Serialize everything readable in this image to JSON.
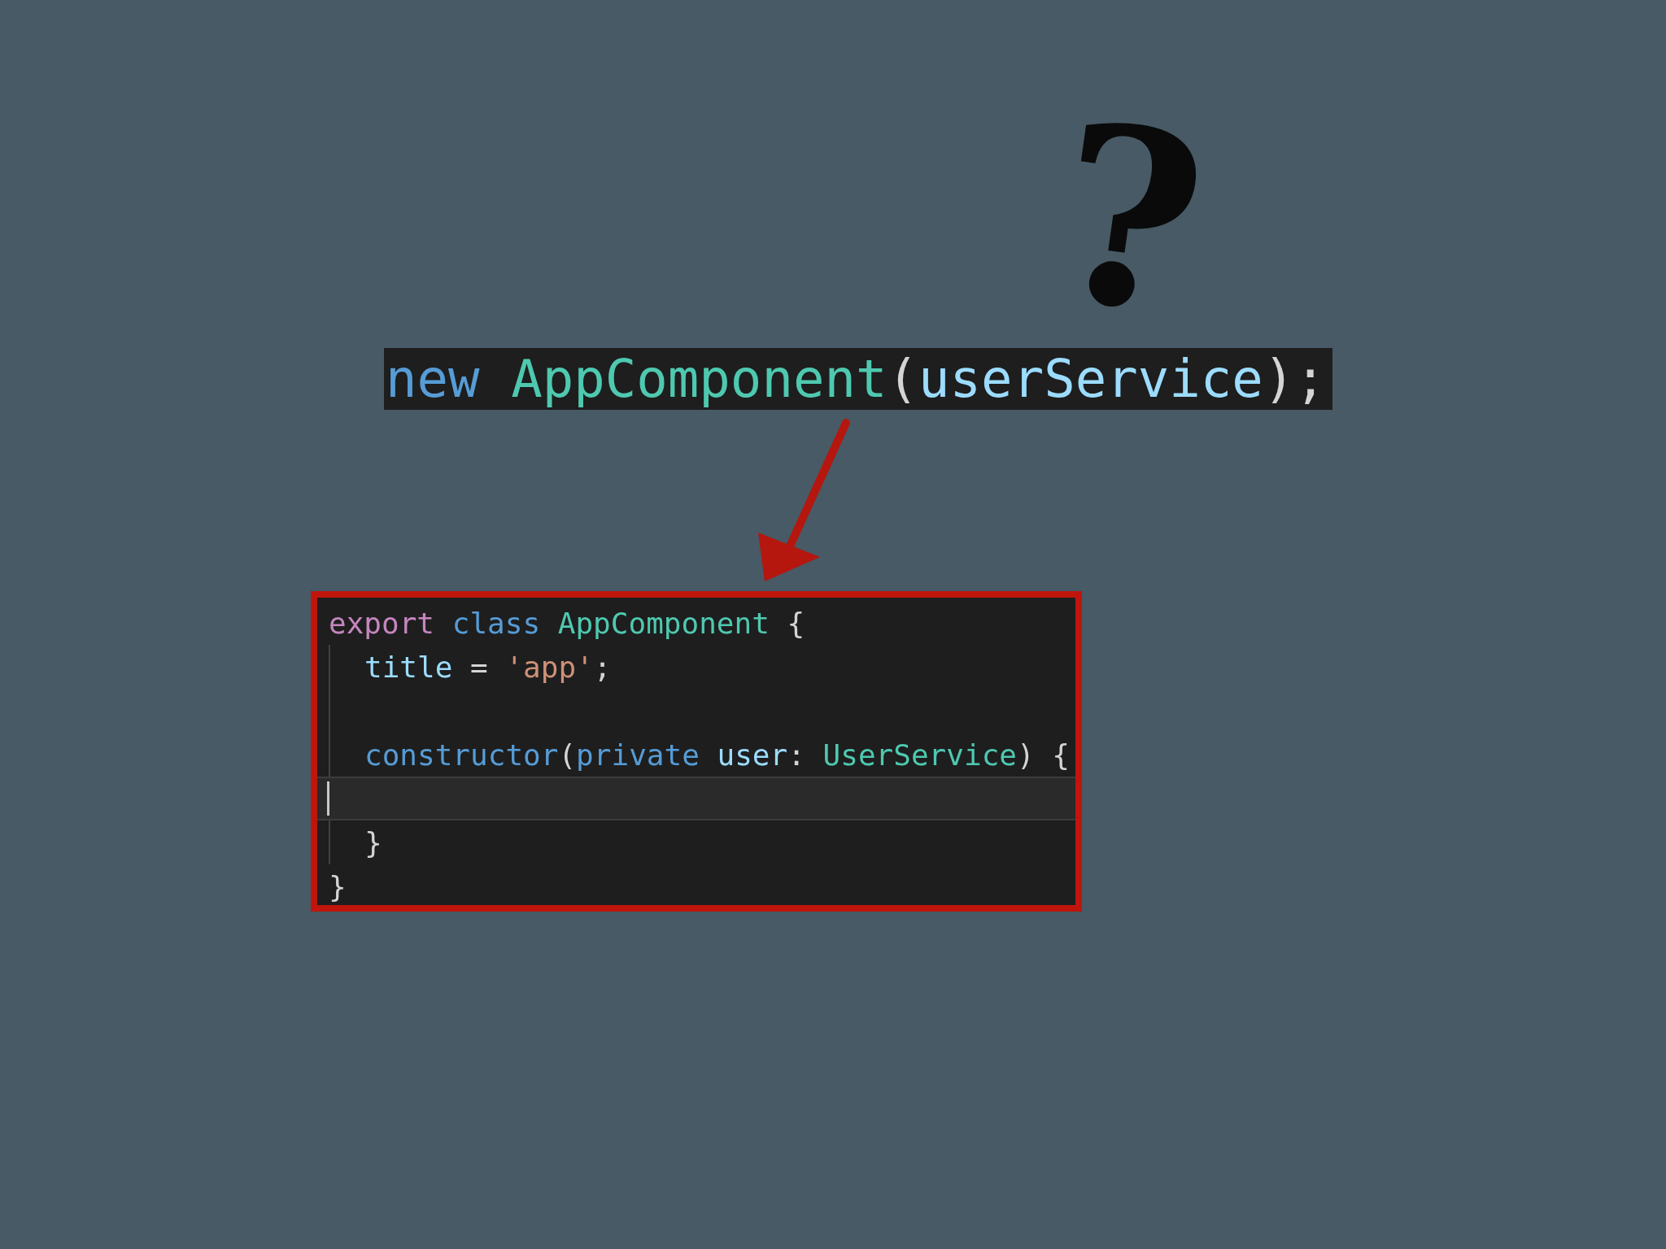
{
  "headline": {
    "tokens": [
      {
        "text": "new ",
        "kind": "keyword"
      },
      {
        "text": "AppComponent",
        "kind": "type"
      },
      {
        "text": "(",
        "kind": "plain"
      },
      {
        "text": "userService",
        "kind": "variable"
      },
      {
        "text": ");",
        "kind": "plain"
      }
    ]
  },
  "question_mark": "?",
  "editor": {
    "lines": [
      {
        "indented": false,
        "highlighted": false,
        "tokens": [
          {
            "text": "export ",
            "kind": "control"
          },
          {
            "text": "class ",
            "kind": "keyword"
          },
          {
            "text": "AppComponent",
            "kind": "type"
          },
          {
            "text": " {",
            "kind": "plain"
          }
        ]
      },
      {
        "indented": true,
        "highlighted": false,
        "tokens": [
          {
            "text": "title",
            "kind": "variable"
          },
          {
            "text": " = ",
            "kind": "plain"
          },
          {
            "text": "'app'",
            "kind": "string"
          },
          {
            "text": ";",
            "kind": "plain"
          }
        ]
      },
      {
        "indented": true,
        "highlighted": false
      },
      {
        "indented": true,
        "highlighted": false,
        "tokens": [
          {
            "text": "constructor",
            "kind": "keyword"
          },
          {
            "text": "(",
            "kind": "plain"
          },
          {
            "text": "private ",
            "kind": "keyword"
          },
          {
            "text": "user",
            "kind": "variable"
          },
          {
            "text": ": ",
            "kind": "plain"
          },
          {
            "text": "UserService",
            "kind": "type"
          },
          {
            "text": ") {",
            "kind": "plain"
          }
        ]
      },
      {
        "indented": false,
        "highlighted": true
      },
      {
        "indented": true,
        "highlighted": false,
        "tokens": [
          {
            "text": "}",
            "kind": "plain"
          }
        ]
      },
      {
        "indented": false,
        "highlighted": false,
        "tokens": [
          {
            "text": "}",
            "kind": "plain"
          }
        ]
      }
    ]
  }
}
